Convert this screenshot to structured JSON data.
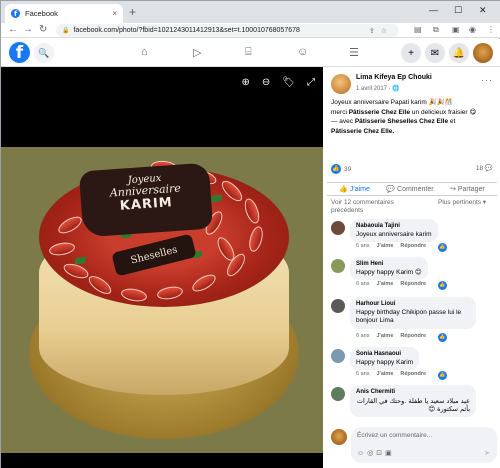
{
  "browser": {
    "tab_title": "Facebook",
    "tab_close": "×",
    "new_tab": "+",
    "minimize": "—",
    "maximize": "☐",
    "close": "✕",
    "back": "←",
    "forward": "→",
    "reload": "↻",
    "url": "facebook.com/photo/?fbid=1021243011412913&set=t.100010768057678",
    "lock": "🔒",
    "omni_icons": "⇪☆"
  },
  "fb_nav": {
    "logo": "f",
    "search_icon": "🔍",
    "plus": "+",
    "messenger": "✉",
    "bell": "🔔"
  },
  "photo_tools": {
    "zoom_in": "⊕",
    "zoom_out": "⊖",
    "tag": "🏷",
    "fullscreen": "⤢"
  },
  "cake": {
    "line1": "Joyeux",
    "line2": "Anniversaire",
    "line3": "KARIM",
    "brand": "Sheselles"
  },
  "post": {
    "author": "Lima Kifeya Ep Chouki",
    "date": "1 avril 2017 · 🌐",
    "text_1": "Joyeux anniversaire Papati karim 🎉🎉🎊",
    "text_2a": "merci ",
    "text_2b": "Pâtisserie Chez Elle",
    "text_2c": " un delicieux fraisier 😋",
    "text_3a": "— avec ",
    "text_3b": "Pâtisserie Sheselles Chez Elle",
    "text_3c": " et",
    "text_4": "Pâtisserie Chez Elle.",
    "more": "···",
    "likes": "39",
    "comments_count": "18 💬",
    "like_label": "J'aime",
    "comment_label": "Commenter",
    "share_label": "Partager",
    "see_more_comments": "Voir 12 commentaires précédents",
    "sort_label": "Plus pertinents ▾"
  },
  "comments": [
    {
      "name": "Nabaouia Tajini",
      "text": "Joyeux anniversaire karim",
      "age": "6 ans",
      "like": "J'aime",
      "reply": "Répondre",
      "color": "#6e4a3a"
    },
    {
      "name": "Slim Heni",
      "text": "Happy happy Karim 😊",
      "age": "6 ans",
      "like": "J'aime",
      "reply": "Répondre",
      "color": "#8a9a5a"
    },
    {
      "name": "Harhour Lioui",
      "text": "Happy birthday Chikipon passe lui le bonjour Lima",
      "age": "6 ans",
      "like": "J'aime",
      "reply": "Répondre",
      "color": "#5a5a5a"
    },
    {
      "name": "Sonia Hasnaoui",
      "text": "Happy happy Karim",
      "age": "6 ans",
      "like": "J'aime",
      "reply": "Répondre",
      "color": "#7a9ab0"
    },
    {
      "name": "Anis Chermiti",
      "text": "عيد ميلاد سعيد يا طفلة .وحتك في القارات بأثم سكتورة 😊",
      "age": "6 ans",
      "like": "J'aime",
      "reply": "Répondre",
      "color": "#5e7d5e"
    }
  ],
  "composer": {
    "placeholder": "Écrivez un commentaire...",
    "tools": "☺◎⊡▣",
    "send": "➤"
  }
}
